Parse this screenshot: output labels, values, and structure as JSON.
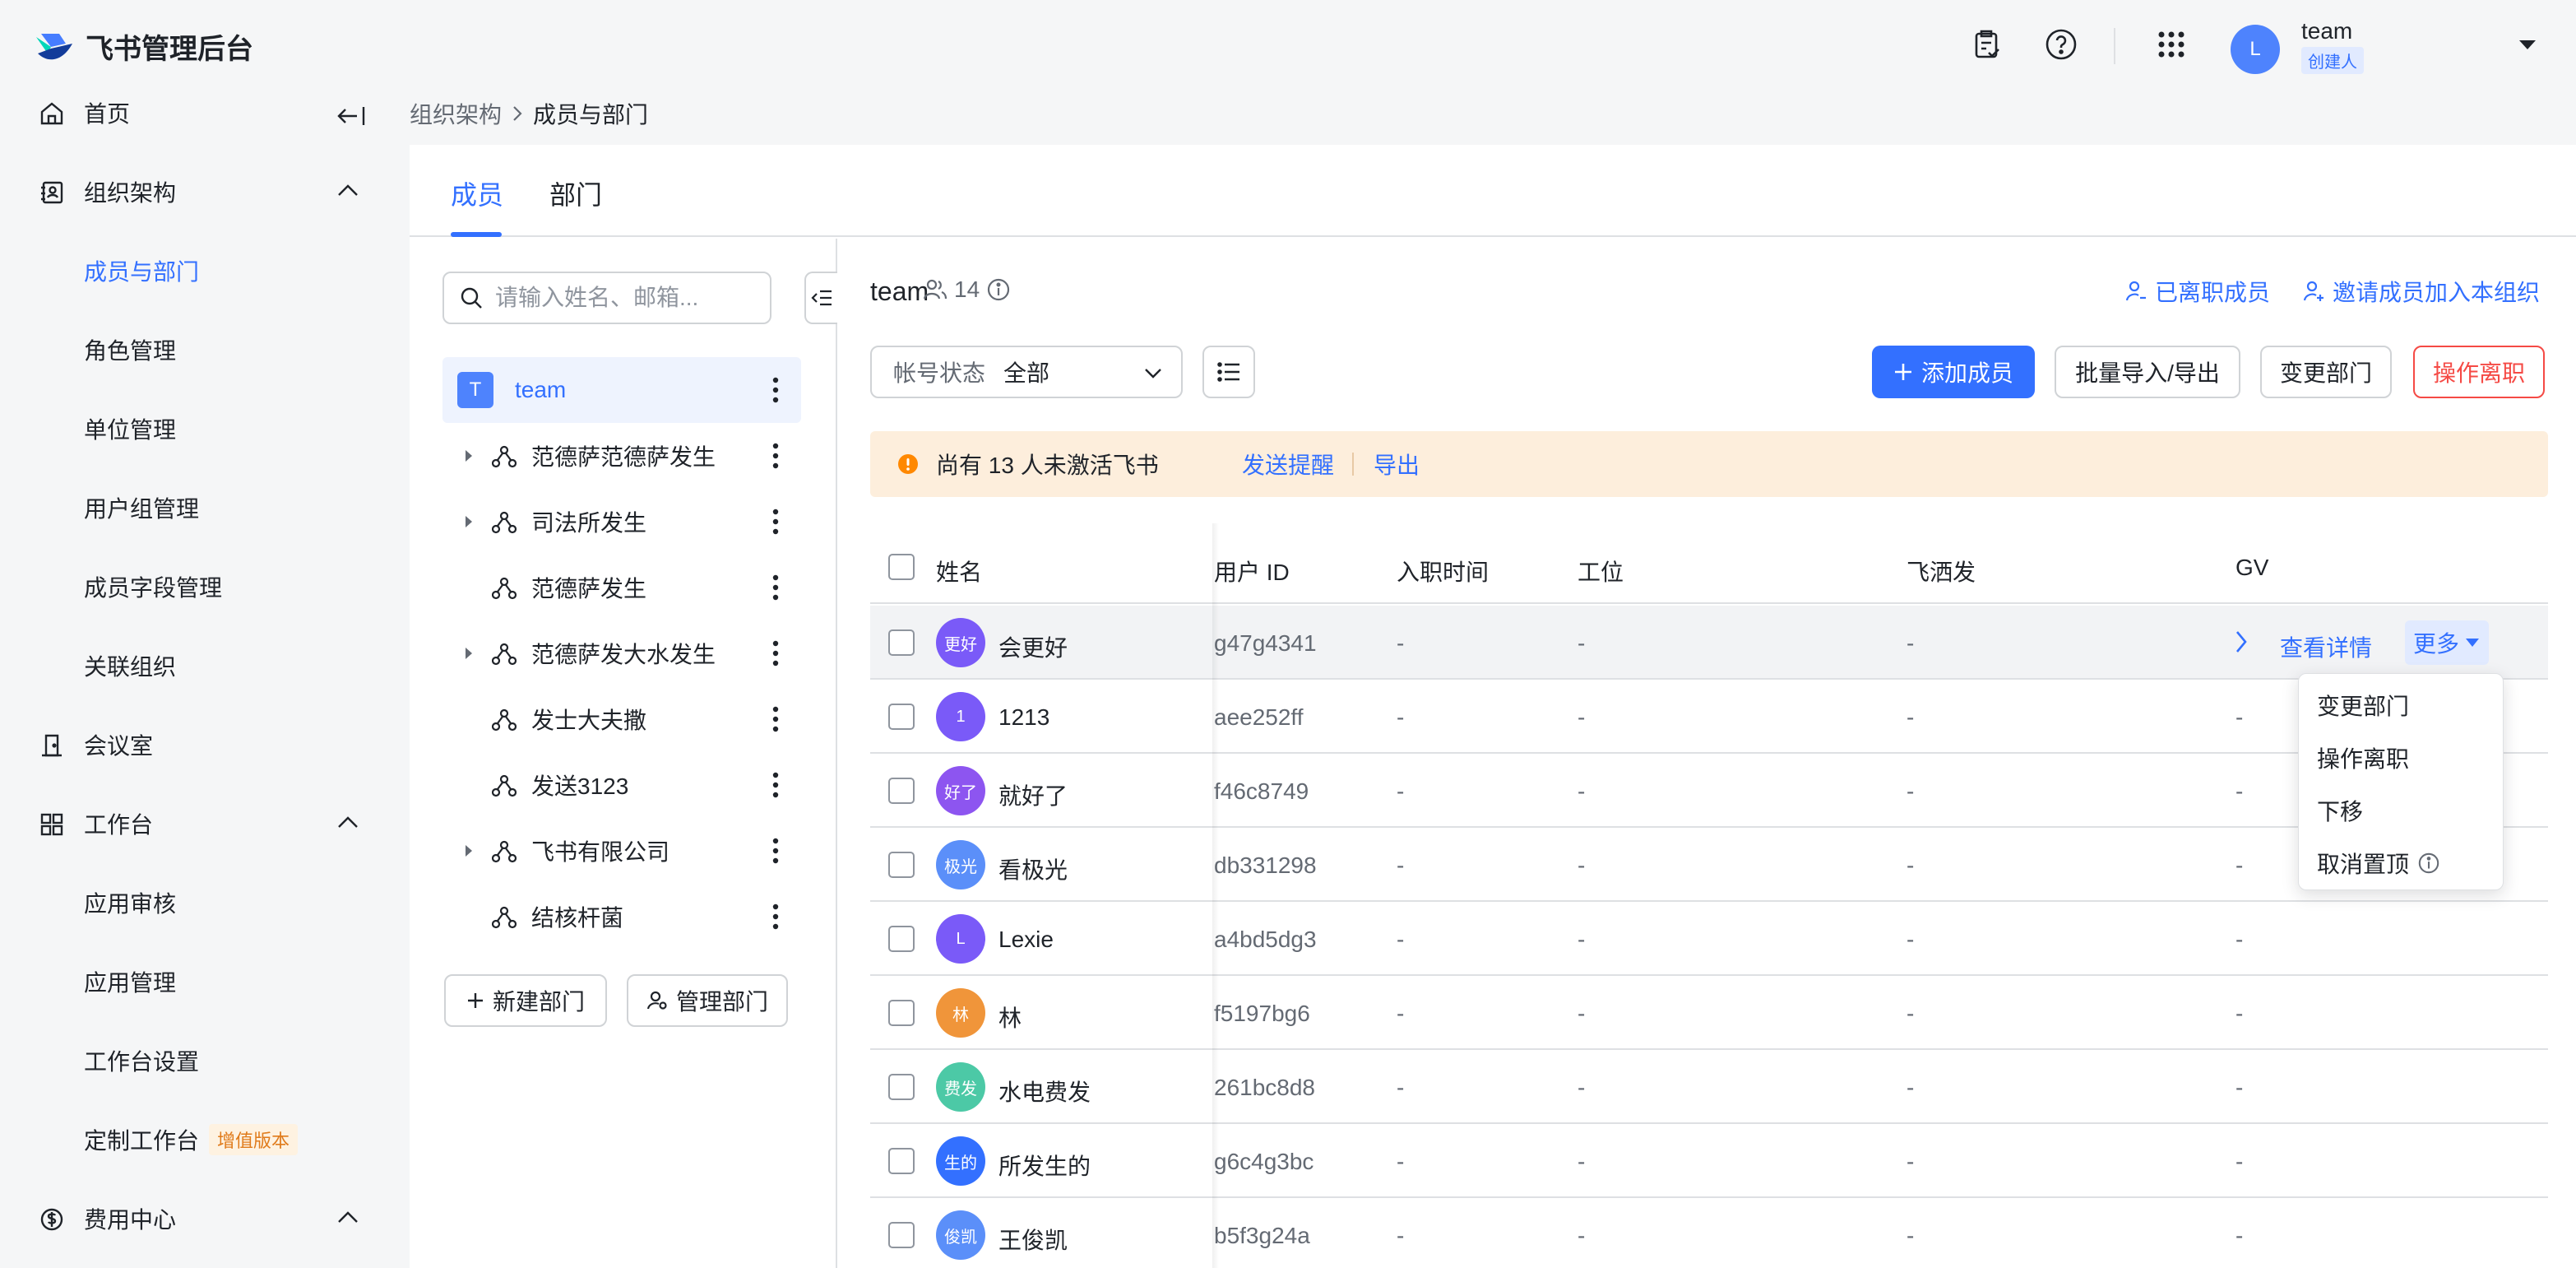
{
  "app": {
    "title": "飞书管理后台"
  },
  "topbar": {
    "user_name": "team",
    "user_role": "创建人",
    "avatar_letter": "L"
  },
  "sidebar": {
    "items": [
      {
        "label": "首页",
        "icon": "home-icon"
      },
      {
        "label": "组织架构",
        "icon": "contacts-icon"
      },
      {
        "label": "成员与部门"
      },
      {
        "label": "角色管理"
      },
      {
        "label": "单位管理"
      },
      {
        "label": "用户组管理"
      },
      {
        "label": "成员字段管理"
      },
      {
        "label": "关联组织"
      },
      {
        "label": "会议室",
        "icon": "meeting-room-icon"
      },
      {
        "label": "工作台",
        "icon": "workbench-icon"
      },
      {
        "label": "应用审核"
      },
      {
        "label": "应用管理"
      },
      {
        "label": "工作台设置"
      },
      {
        "label": "定制工作台",
        "badge": "增值版本"
      },
      {
        "label": "费用中心",
        "icon": "billing-icon"
      }
    ]
  },
  "breadcrumb": [
    "组织架构",
    "成员与部门"
  ],
  "tabs": [
    "成员",
    "部门"
  ],
  "tree": {
    "search_placeholder": "请输入姓名、邮箱...",
    "root": {
      "avatar": "T",
      "name": "team"
    },
    "nodes": [
      {
        "name": "范德萨范德萨发生",
        "expandable": true
      },
      {
        "name": "司法所发生",
        "expandable": true
      },
      {
        "name": "范德萨发生",
        "expandable": false
      },
      {
        "name": "范德萨发大水发生",
        "expandable": true
      },
      {
        "name": "发士大夫撒",
        "expandable": false
      },
      {
        "name": "发送3123",
        "expandable": false
      },
      {
        "name": "飞书有限公司",
        "expandable": true
      },
      {
        "name": "结核杆菌",
        "expandable": false
      }
    ],
    "new_dept": "新建部门",
    "manage_dept": "管理部门"
  },
  "members": {
    "title": "team",
    "count": "14",
    "resigned_link": "已离职成员",
    "invite_link": "邀请成员加入本组织",
    "filter_label": "帐号状态",
    "filter_value": "全部",
    "add_member": "添加成员",
    "bulk": "批量导入/导出",
    "change_dept": "变更部门",
    "resign": "操作离职"
  },
  "banner": {
    "text": "尚有 13 人未激活飞书",
    "remind": "发送提醒",
    "export": "导出"
  },
  "table": {
    "headers": [
      "姓名",
      "用户 ID",
      "入职时间",
      "工位",
      "飞洒发",
      "GV"
    ],
    "rows": [
      {
        "avatar": "更好",
        "color": "#7a5af8",
        "name": "会更好",
        "id": "g47g4341",
        "join": "-",
        "seat": "-",
        "c1": "-",
        "gv": ""
      },
      {
        "avatar": "1",
        "color": "#7a5af8",
        "name": "1213",
        "id": "aee252ff",
        "join": "-",
        "seat": "-",
        "c1": "-",
        "gv": "-"
      },
      {
        "avatar": "好了",
        "color": "#8d55f0",
        "name": "就好了",
        "id": "f46c8749",
        "join": "-",
        "seat": "-",
        "c1": "-",
        "gv": "-"
      },
      {
        "avatar": "极光",
        "color": "#5b8ff9",
        "name": "看极光",
        "id": "db331298",
        "join": "-",
        "seat": "-",
        "c1": "-",
        "gv": "-"
      },
      {
        "avatar": "L",
        "color": "#7a5af8",
        "name": "Lexie",
        "id": "a4bd5dg3",
        "join": "-",
        "seat": "-",
        "c1": "-",
        "gv": "-"
      },
      {
        "avatar": "林",
        "color": "#f0953a",
        "name": "林",
        "id": "f5197bg6",
        "join": "-",
        "seat": "-",
        "c1": "-",
        "gv": "-"
      },
      {
        "avatar": "费发",
        "color": "#4cc9a6",
        "name": "水电费发",
        "id": "261bc8d8",
        "join": "-",
        "seat": "-",
        "c1": "-",
        "gv": "-"
      },
      {
        "avatar": "生的",
        "color": "#3370ff",
        "name": "所发生的",
        "id": "g6c4g3bc",
        "join": "-",
        "seat": "-",
        "c1": "-",
        "gv": "-"
      },
      {
        "avatar": "俊凯",
        "color": "#5b8ff9",
        "name": "王俊凯",
        "id": "b5f3g24a",
        "join": "-",
        "seat": "-",
        "c1": "-",
        "gv": "-"
      }
    ],
    "row_actions": {
      "detail": "查看详情",
      "more": "更多"
    }
  },
  "dropdown": {
    "items": [
      "变更部门",
      "操作离职",
      "下移",
      "取消置顶"
    ]
  }
}
